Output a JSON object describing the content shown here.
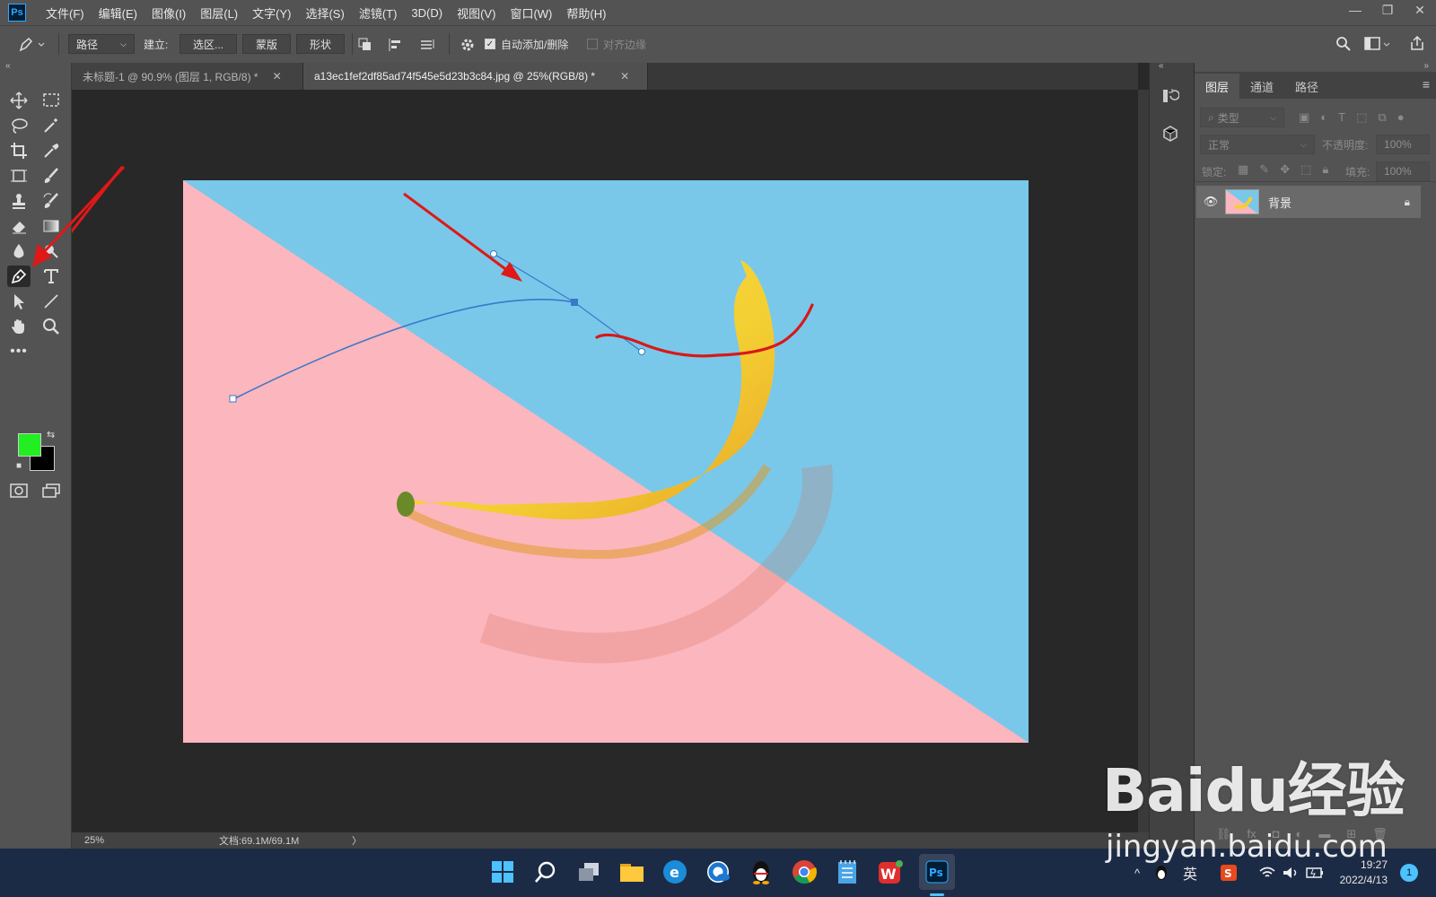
{
  "app": {
    "logo_text": "Ps"
  },
  "menu": [
    "文件(F)",
    "编辑(E)",
    "图像(I)",
    "图层(L)",
    "文字(Y)",
    "选择(S)",
    "滤镜(T)",
    "3D(D)",
    "视图(V)",
    "窗口(W)",
    "帮助(H)"
  ],
  "window_controls": {
    "minimize": "—",
    "restore": "❐",
    "close": "✕"
  },
  "options": {
    "mode_value": "路径",
    "build_label": "建立:",
    "selection_btn": "选区...",
    "mask_btn": "蒙版",
    "shape_btn": "形状",
    "auto_add_delete_label": "自动添加/删除",
    "align_edges_label": "对齐边缘"
  },
  "tabs": [
    {
      "label": "未标题-1 @ 90.9% (图层 1, RGB/8) *",
      "close": "✕",
      "active": false
    },
    {
      "label": "a13ec1fef2df85ad74f545e5d23b3c84.jpg @ 25%(RGB/8) *",
      "close": "✕",
      "active": true
    }
  ],
  "colors": {
    "foreground": "#22ee22",
    "background": "#000000",
    "photo_pink": "#fcb6bd",
    "photo_blue": "#79c8ea",
    "banana": "#f3cf32",
    "path_line": "#3a78c8",
    "annotation_red": "#e01818"
  },
  "status": {
    "zoom": "25%",
    "doc_size": "文档:69.1M/69.1M",
    "arrow": "〉"
  },
  "panel": {
    "tabs": [
      "图层",
      "通道",
      "路径"
    ],
    "filter_kind": "类型",
    "blend_mode": "正常",
    "opacity_label": "不透明度:",
    "opacity_value": "100%",
    "lock_label": "锁定:",
    "fill_label": "填充:",
    "fill_value": "100%",
    "layers": [
      {
        "name": "背景",
        "visible": true,
        "locked": true
      }
    ]
  },
  "taskbar": {
    "ime": "英",
    "time": "19:27",
    "date": "2022/4/13",
    "notification_count": "1"
  },
  "watermark": {
    "logo_text": "Baidu经验",
    "url": "jingyan.baidu.com"
  }
}
